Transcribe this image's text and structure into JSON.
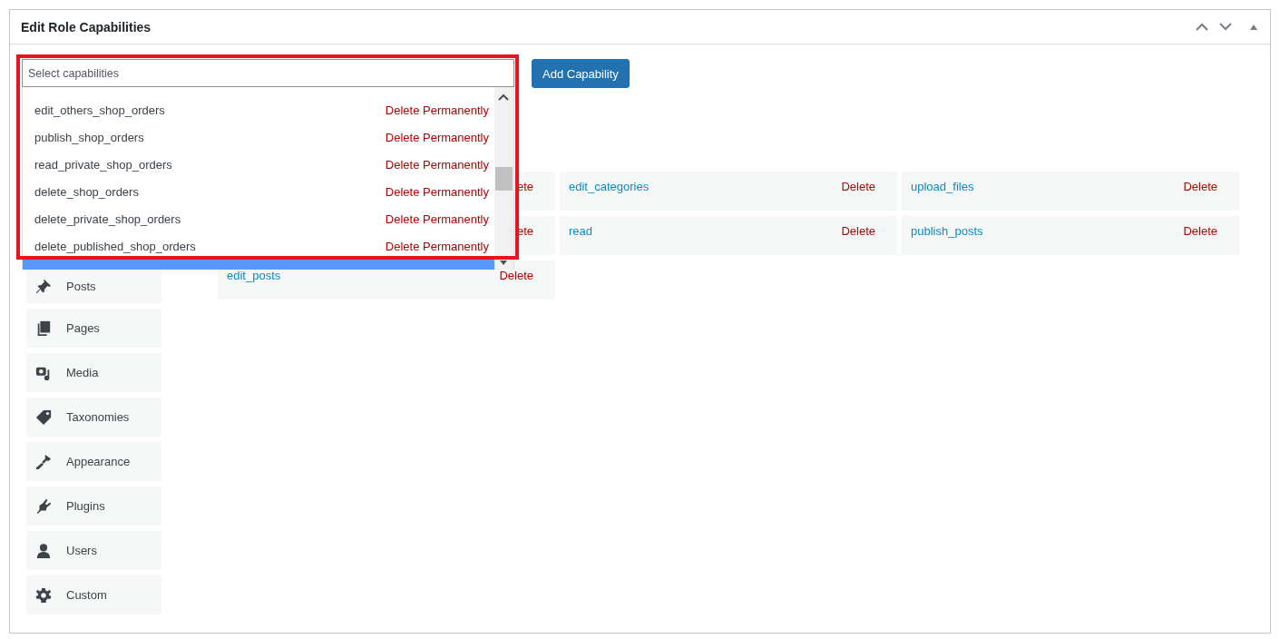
{
  "panel": {
    "title": "Edit Role Capabilities"
  },
  "capability_select": {
    "placeholder": "Select capabilities",
    "options": [
      {
        "name": "edit_others_shop_orders",
        "action": "Delete Permanently"
      },
      {
        "name": "publish_shop_orders",
        "action": "Delete Permanently"
      },
      {
        "name": "read_private_shop_orders",
        "action": "Delete Permanently"
      },
      {
        "name": "delete_shop_orders",
        "action": "Delete Permanently"
      },
      {
        "name": "delete_private_shop_orders",
        "action": "Delete Permanently"
      },
      {
        "name": "delete_published_shop_orders",
        "action": "Delete Permanently"
      }
    ]
  },
  "add_button": "Add Capability",
  "sidebar": {
    "items": [
      {
        "label": "Posts"
      },
      {
        "label": "Pages"
      },
      {
        "label": "Media"
      },
      {
        "label": "Taxonomies"
      },
      {
        "label": "Appearance"
      },
      {
        "label": "Plugins"
      },
      {
        "label": "Users"
      },
      {
        "label": "Custom"
      }
    ]
  },
  "capabilities": [
    {
      "delete": "ete"
    },
    {
      "name": "edit_categories",
      "delete": "Delete"
    },
    {
      "name": "upload_files",
      "delete": "Delete"
    },
    {
      "delete": "ete"
    },
    {
      "name": "read",
      "delete": "Delete"
    },
    {
      "name": "publish_posts",
      "delete": "Delete"
    },
    {
      "name": "edit_posts",
      "delete": "Delete"
    }
  ]
}
